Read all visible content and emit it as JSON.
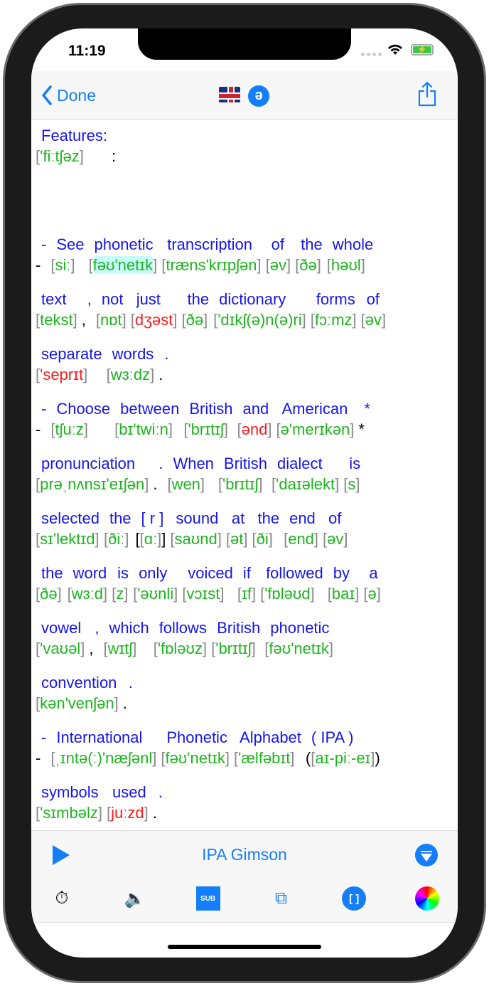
{
  "status": {
    "time": "11:19"
  },
  "nav": {
    "back_label": "Done",
    "schwa": "ə"
  },
  "colors": {
    "accent": "#147efb",
    "english": "#1515f0",
    "ipa": "#1db51d",
    "ipa_alt": "#ff1a1a",
    "bracket": "#8a8a8a",
    "highlight": "#c8fbfb"
  },
  "lines": [
    [
      {
        "w": "Features:",
        "p": "'fiːtʃəz",
        "c": "g"
      },
      {
        "w": "",
        "p": ":",
        "plain": true
      }
    ],
    "blank",
    [
      {
        "w": "-",
        "p": "-",
        "plain": true
      },
      {
        "w": "See",
        "p": "siː",
        "c": "g"
      },
      {
        "w": "phonetic",
        "p": "fəʊ'netɪk",
        "c": "g",
        "hl": true
      },
      {
        "w": "transcription",
        "p": "træns'krɪpʃən",
        "c": "g"
      },
      {
        "w": "of",
        "p": "əv",
        "c": "g"
      },
      {
        "w": "the",
        "p": "ðə",
        "c": "g"
      },
      {
        "w": "whole",
        "p": "həʊl",
        "c": "g"
      }
    ],
    [
      {
        "w": "text",
        "p": "tekst",
        "c": "g"
      },
      {
        "w": ",",
        "p": ",",
        "plain": true
      },
      {
        "w": "not",
        "p": "nɒt",
        "c": "g"
      },
      {
        "w": "just",
        "p": "dʒəst",
        "c": "r"
      },
      {
        "w": "the",
        "p": "ðə",
        "c": "g"
      },
      {
        "w": "dictionary",
        "p": "'dɪkʃ(ə)n(ə)ri",
        "c": "g"
      },
      {
        "w": "forms",
        "p": "fɔːmz",
        "c": "g"
      },
      {
        "w": "of",
        "p": "əv",
        "c": "g"
      }
    ],
    [
      {
        "w": "separate",
        "p": "'seprɪt",
        "c": "r"
      },
      {
        "w": "words",
        "p": "wɜːdz",
        "c": "g"
      },
      {
        "w": ".",
        "p": ".",
        "plain": true
      }
    ],
    [
      {
        "w": "-",
        "p": "-",
        "plain": true
      },
      {
        "w": "Choose",
        "p": "tʃuːz",
        "c": "g"
      },
      {
        "w": "between",
        "p": "bɪ'twiːn",
        "c": "g"
      },
      {
        "w": "British",
        "p": "'brɪtɪʃ",
        "c": "g"
      },
      {
        "w": "and",
        "p": "ənd",
        "c": "r"
      },
      {
        "w": "American",
        "p": "ə'merɪkən",
        "c": "g"
      },
      {
        "w": "*",
        "p": "*",
        "plain": true
      }
    ],
    [
      {
        "w": "pronunciation",
        "p": "prəˌnʌnsɪ'eɪʃən",
        "c": "g"
      },
      {
        "w": ".",
        "p": ".",
        "plain": true
      },
      {
        "w": "When",
        "p": "wen",
        "c": "g"
      },
      {
        "w": "British",
        "p": "'brɪtɪʃ",
        "c": "g"
      },
      {
        "w": "dialect",
        "p": "'daɪəlekt",
        "c": "g"
      },
      {
        "w": "is",
        "p": "s",
        "c": "g"
      }
    ],
    [
      {
        "w": "selected",
        "p": "sɪ'lektɪd",
        "c": "g"
      },
      {
        "w": "the",
        "p": "ðiː",
        "c": "g"
      },
      {
        "w": "[ r ]",
        "p": "ɑː",
        "c": "g",
        "pre": "[",
        "post": "]"
      },
      {
        "w": "sound",
        "p": "saʊnd",
        "c": "g"
      },
      {
        "w": "at",
        "p": "ət",
        "c": "g"
      },
      {
        "w": "the",
        "p": "ði",
        "c": "g"
      },
      {
        "w": "end",
        "p": "end",
        "c": "g"
      },
      {
        "w": "of",
        "p": "əv",
        "c": "g"
      }
    ],
    [
      {
        "w": "the",
        "p": "ðə",
        "c": "g"
      },
      {
        "w": "word",
        "p": "wɜːd",
        "c": "g"
      },
      {
        "w": "is",
        "p": "z",
        "c": "g"
      },
      {
        "w": "only",
        "p": "'əʊnli",
        "c": "g"
      },
      {
        "w": "voiced",
        "p": "vɔɪst",
        "c": "g"
      },
      {
        "w": "if",
        "p": "ɪf",
        "c": "g"
      },
      {
        "w": "followed",
        "p": "'fɒləʊd",
        "c": "g"
      },
      {
        "w": "by",
        "p": "baɪ",
        "c": "g"
      },
      {
        "w": "a",
        "p": "ə",
        "c": "g"
      }
    ],
    [
      {
        "w": "vowel",
        "p": "'vaʊəl",
        "c": "g"
      },
      {
        "w": ",",
        "p": ",",
        "plain": true
      },
      {
        "w": "which",
        "p": "wɪtʃ",
        "c": "g"
      },
      {
        "w": "follows",
        "p": "'fɒləʊz",
        "c": "g"
      },
      {
        "w": "British",
        "p": "'brɪtɪʃ",
        "c": "g"
      },
      {
        "w": "phonetic",
        "p": "fəʊ'netɪk",
        "c": "g"
      }
    ],
    [
      {
        "w": "convention",
        "p": "kən'venʃən",
        "c": "g"
      },
      {
        "w": ".",
        "p": ".",
        "plain": true
      }
    ],
    [
      {
        "w": "-",
        "p": "-",
        "plain": true
      },
      {
        "w": "International",
        "p": "ˌɪntə(ː)'næʃənl",
        "c": "g"
      },
      {
        "w": "Phonetic",
        "p": "fəʊ'netɪk",
        "c": "g"
      },
      {
        "w": "Alphabet",
        "p": "'ælfəbɪt",
        "c": "g"
      },
      {
        "w": "( IPA )",
        "p": "aɪ-piː-eɪ",
        "c": "g",
        "pre": "(",
        "post": ")"
      }
    ],
    [
      {
        "w": "symbols",
        "p": "'sɪmbəlz",
        "c": "g"
      },
      {
        "w": "used",
        "p": "juːzd",
        "c": "r"
      },
      {
        "w": ".",
        "p": ".",
        "plain": true
      }
    ]
  ],
  "bottom": {
    "dialect_label": "IPA Gimson",
    "tools": [
      {
        "name": "timer-person-icon",
        "glyph": "⏱"
      },
      {
        "name": "hand-speaker-icon",
        "glyph": "🔈"
      },
      {
        "name": "subtitles-clapper-icon",
        "glyph": "🎬"
      },
      {
        "name": "copy-pages-icon",
        "glyph": "⧉"
      },
      {
        "name": "brackets-icon",
        "glyph": "[ ]"
      },
      {
        "name": "color-wheel-icon",
        "glyph": ""
      }
    ]
  }
}
